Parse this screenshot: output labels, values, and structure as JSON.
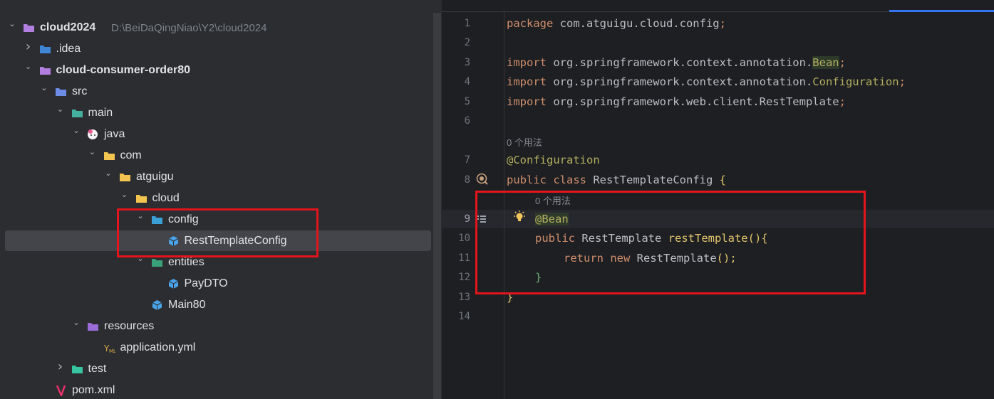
{
  "project_tree": {
    "rows": [
      {
        "label": "cloud2024",
        "path": "D:\\BeiDaQingNiao\\Y2\\cloud2024",
        "chevron": "down",
        "icon": "module-folder-icon"
      },
      {
        "label": ".idea",
        "chevron": "right",
        "icon": "idea-folder-icon"
      },
      {
        "label": "cloud-consumer-order80",
        "chevron": "down",
        "icon": "module-folder-icon"
      },
      {
        "label": "src",
        "chevron": "down",
        "icon": "source-folder-icon"
      },
      {
        "label": "main",
        "chevron": "down",
        "icon": "folder-icon"
      },
      {
        "label": "java",
        "chevron": "down",
        "icon": "java-source-icon"
      },
      {
        "label": "com",
        "chevron": "down",
        "icon": "package-folder-icon"
      },
      {
        "label": "atguigu",
        "chevron": "down",
        "icon": "package-folder-icon"
      },
      {
        "label": "cloud",
        "chevron": "down",
        "icon": "package-folder-icon"
      },
      {
        "label": "config",
        "chevron": "down",
        "icon": "config-package-icon"
      },
      {
        "label": "RestTemplateConfig",
        "chevron": "",
        "icon": "java-class-icon",
        "selected": true
      },
      {
        "label": "entities",
        "chevron": "down",
        "icon": "entities-package-icon"
      },
      {
        "label": "PayDTO",
        "chevron": "",
        "icon": "java-class-icon"
      },
      {
        "label": "Main80",
        "chevron": "",
        "icon": "spring-boot-main-class-icon"
      },
      {
        "label": "resources",
        "chevron": "down",
        "icon": "resources-folder-icon"
      },
      {
        "label": "application.yml",
        "chevron": "",
        "icon": "yaml-file-icon"
      },
      {
        "label": "test",
        "chevron": "right",
        "icon": "test-folder-icon"
      },
      {
        "label": "pom.xml",
        "chevron": "",
        "icon": "maven-icon"
      }
    ]
  },
  "editor": {
    "line_numbers": [
      "1",
      "2",
      "3",
      "4",
      "5",
      "6",
      "7",
      "8",
      "9",
      "10",
      "11",
      "12",
      "13",
      "14"
    ],
    "current_line": "9",
    "usage_hint_1": "0 个用法",
    "usage_hint_2": "0 个用法",
    "code": {
      "l1_kw": "package",
      "l1_rest": " com.atguigu.cloud.config",
      "semi": ";",
      "import_kw": "import",
      "l3_pkg": " org.springframework.context.annotation.",
      "l3_cls": "Bean",
      "l4_pkg": " org.springframework.context.annotation.",
      "l4_cls": "Configuration",
      "l5_pkg": " org.springframework.web.client.RestTemplate",
      "l7_ann": "@Configuration",
      "l8_public": "public",
      "l8_class": "class",
      "l8_name": " RestTemplateConfig ",
      "l8_brace": "{",
      "l9_ann": "@Bean",
      "l10_public": "public",
      "l10_type": " RestTemplate ",
      "l10_method": "restTemplate",
      "l10_parens": "(){",
      "l11_return": "return",
      "l11_new": "new",
      "l11_rest": " RestTemplate",
      "l11_end": "();",
      "l12_brace": "}",
      "l13_brace": "}"
    }
  },
  "colors": {
    "highlight_box": "#e3141b",
    "keyword": "#cf8e6d",
    "annotation": "#b3ae60",
    "method": "#56a8f5",
    "tab_indicator": "#3574f0"
  }
}
